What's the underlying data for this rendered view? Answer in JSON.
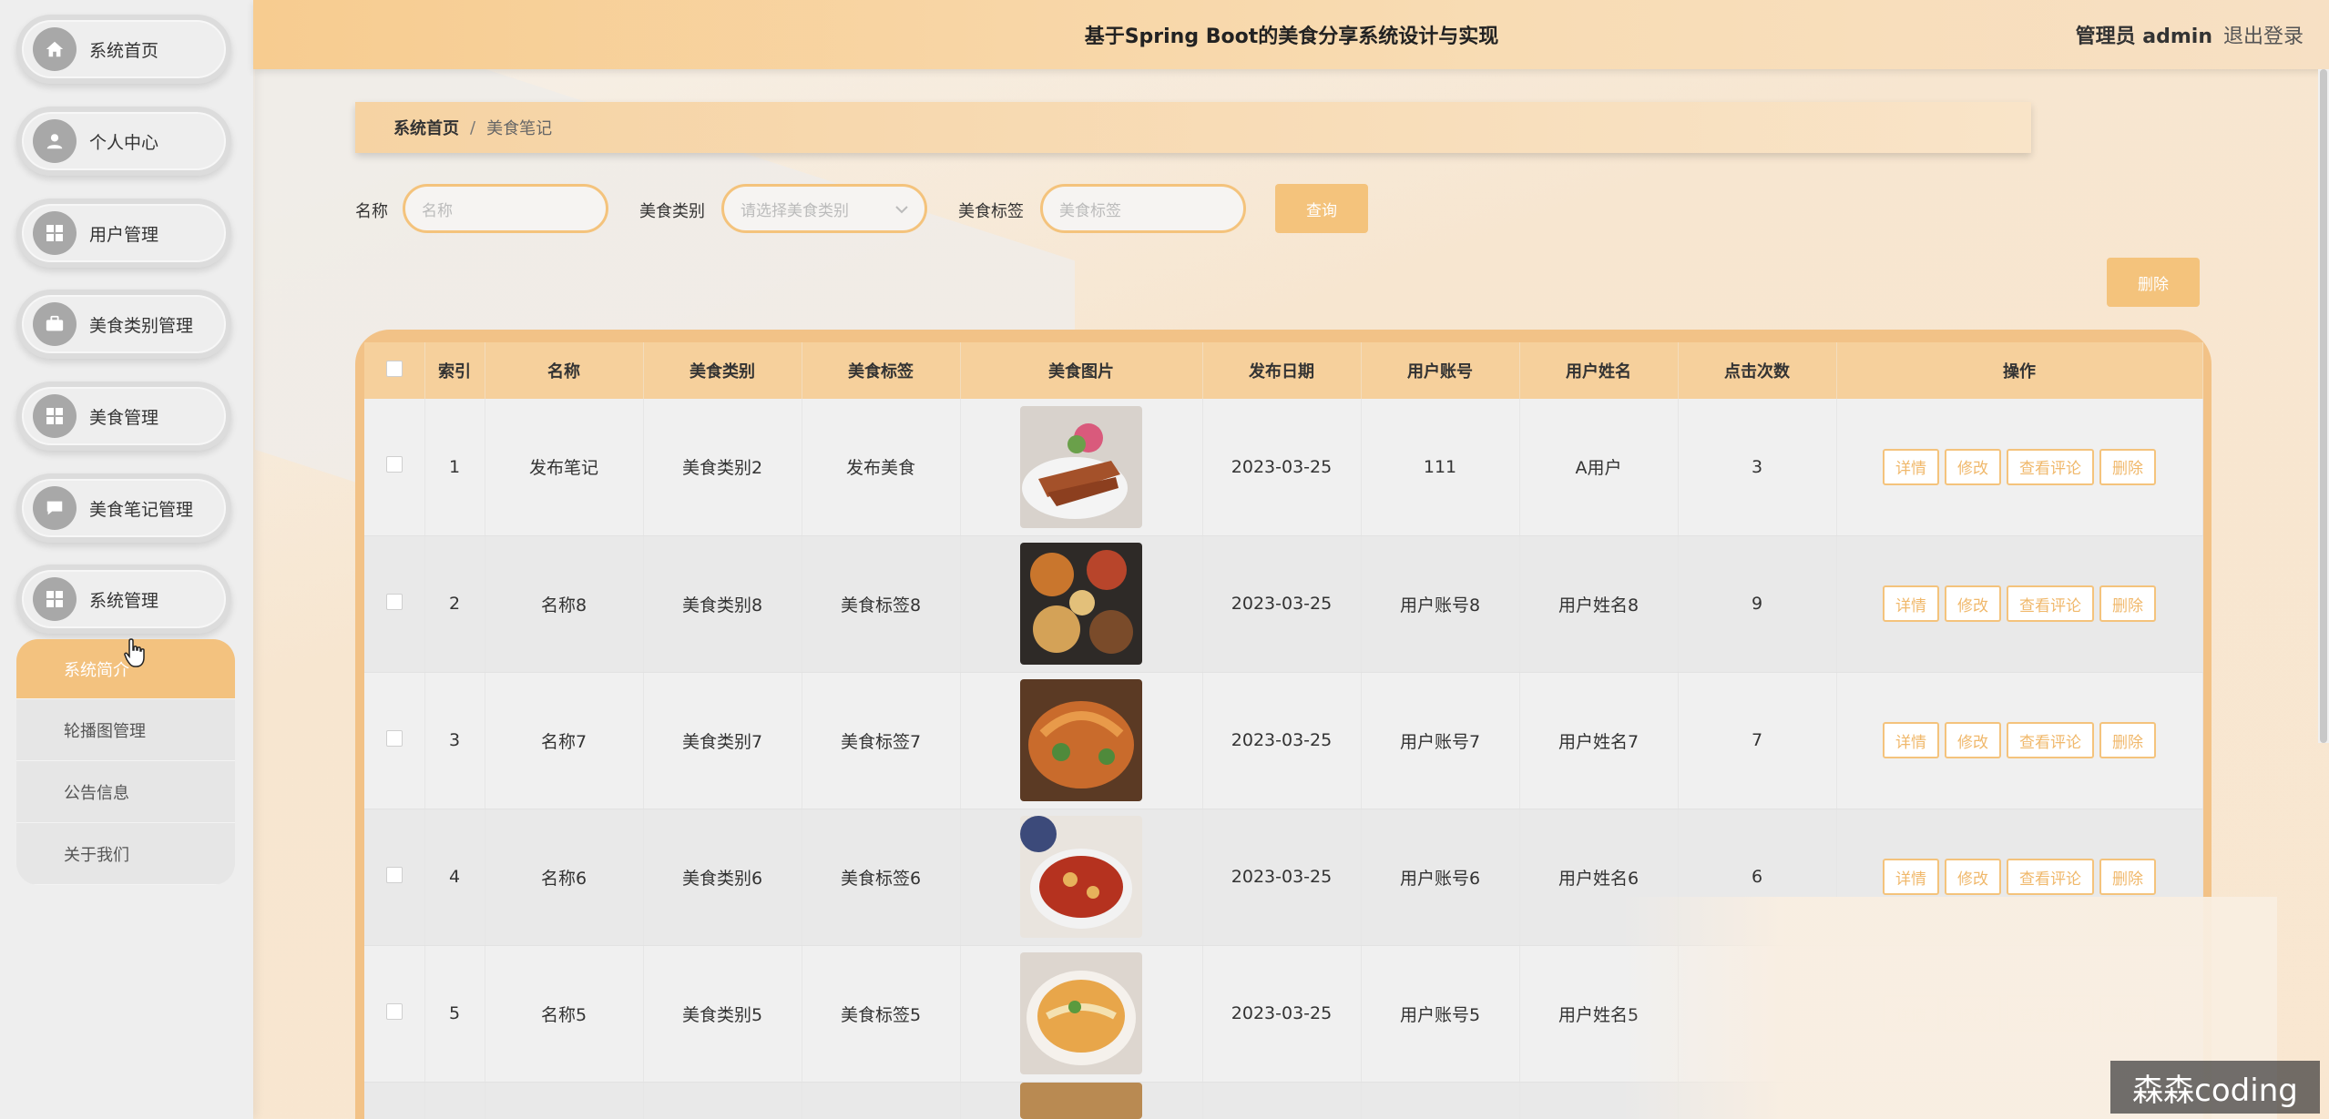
{
  "header": {
    "title": "基于Spring Boot的美食分享系统设计与实现",
    "admin": "管理员 admin",
    "logout": "退出登录"
  },
  "sidebar": {
    "items": [
      {
        "label": "系统首页",
        "icon": "home-icon"
      },
      {
        "label": "个人中心",
        "icon": "user-icon"
      },
      {
        "label": "用户管理",
        "icon": "grid-icon"
      },
      {
        "label": "美食类别管理",
        "icon": "briefcase-icon"
      },
      {
        "label": "美食管理",
        "icon": "grid-icon"
      },
      {
        "label": "美食笔记管理",
        "icon": "chat-icon"
      },
      {
        "label": "系统管理",
        "icon": "grid-icon"
      }
    ],
    "submenu": [
      {
        "label": "系统简介",
        "active": true
      },
      {
        "label": "轮播图管理",
        "active": false
      },
      {
        "label": "公告信息",
        "active": false
      },
      {
        "label": "关于我们",
        "active": false
      }
    ]
  },
  "breadcrumb": {
    "home": "系统首页",
    "separator": "/",
    "current": "美食笔记"
  },
  "search": {
    "name_label": "名称",
    "name_placeholder": "名称",
    "category_label": "美食类别",
    "category_placeholder": "请选择美食类别",
    "tag_label": "美食标签",
    "tag_placeholder": "美食标签",
    "query_button": "查询"
  },
  "delete_button": "删除",
  "table": {
    "headers": [
      "索引",
      "名称",
      "美食类别",
      "美食标签",
      "美食图片",
      "发布日期",
      "用户账号",
      "用户姓名",
      "点击次数",
      "操作"
    ],
    "rows": [
      {
        "index": "1",
        "name": "发布笔记",
        "category": "美食类别2",
        "tag": "发布美食",
        "date": "2023-03-25",
        "account": "111",
        "username": "A用户",
        "clicks": "3"
      },
      {
        "index": "2",
        "name": "名称8",
        "category": "美食类别8",
        "tag": "美食标签8",
        "date": "2023-03-25",
        "account": "用户账号8",
        "username": "用户姓名8",
        "clicks": "9"
      },
      {
        "index": "3",
        "name": "名称7",
        "category": "美食类别7",
        "tag": "美食标签7",
        "date": "2023-03-25",
        "account": "用户账号7",
        "username": "用户姓名7",
        "clicks": "7"
      },
      {
        "index": "4",
        "name": "名称6",
        "category": "美食类别6",
        "tag": "美食标签6",
        "date": "2023-03-25",
        "account": "用户账号6",
        "username": "用户姓名6",
        "clicks": "6"
      },
      {
        "index": "5",
        "name": "名称5",
        "category": "美食类别5",
        "tag": "美食标签5",
        "date": "2023-03-25",
        "account": "用户账号5",
        "username": "用户姓名5",
        "clicks": ""
      }
    ],
    "actions": [
      "详情",
      "修改",
      "查看评论",
      "删除"
    ]
  },
  "watermark": "森森coding",
  "colors": {
    "accent": "#f4c37c",
    "header": "#f7cc90"
  }
}
